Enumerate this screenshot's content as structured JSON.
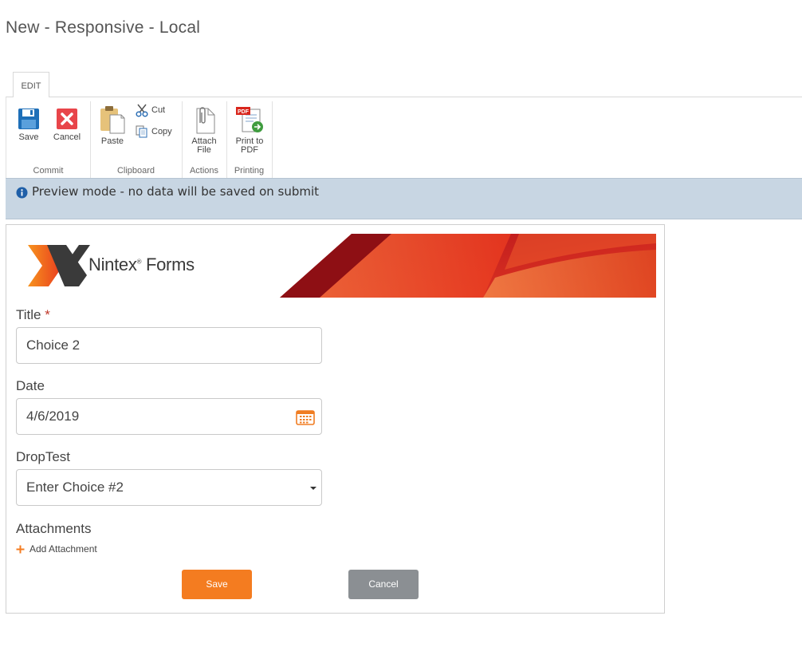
{
  "page": {
    "title": "New - Responsive - Local"
  },
  "ribbon": {
    "tab": "EDIT",
    "groups": {
      "commit": {
        "label": "Commit",
        "save": "Save",
        "cancel": "Cancel"
      },
      "clipboard": {
        "label": "Clipboard",
        "paste": "Paste",
        "cut": "Cut",
        "copy": "Copy"
      },
      "actions": {
        "label": "Actions",
        "attach_line1": "Attach",
        "attach_line2": "File"
      },
      "printing": {
        "label": "Printing",
        "print_line1": "Print to",
        "print_line2": "PDF",
        "pdf_badge": "PDF"
      }
    }
  },
  "preview": {
    "message": "Preview mode - no data will be saved on submit"
  },
  "form": {
    "banner": {
      "brand": "Nintex",
      "product": "Forms",
      "reg": "®"
    },
    "title_field": {
      "label": "Title",
      "required_mark": "*",
      "value": "Choice 2"
    },
    "date_field": {
      "label": "Date",
      "value": "4/6/2019"
    },
    "drop_field": {
      "label": "DropTest",
      "value": "Enter Choice #2"
    },
    "attachments": {
      "label": "Attachments",
      "add_label": "Add Attachment"
    },
    "buttons": {
      "save": "Save",
      "cancel": "Cancel"
    }
  },
  "colors": {
    "accent_orange": "#f47c20",
    "cancel_gray": "#8b8f93",
    "preview_bar": "#c8d6e3",
    "banner_red": "#d9261c"
  }
}
